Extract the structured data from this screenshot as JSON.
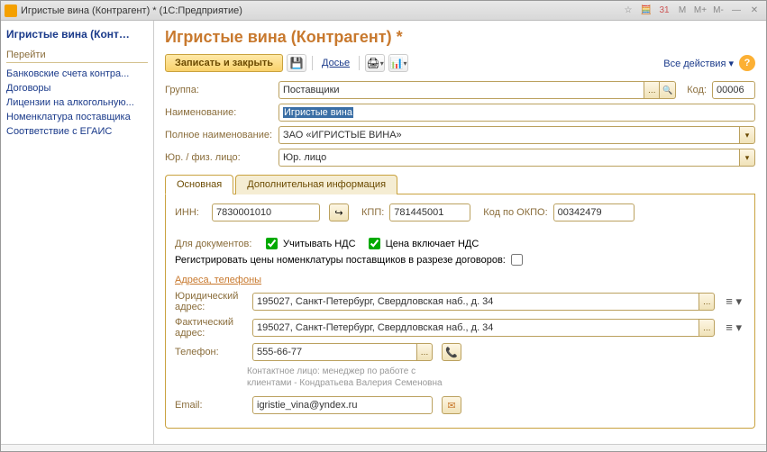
{
  "window": {
    "title": "Игристые вина (Контрагент) * (1С:Предприятие)",
    "controls": {
      "star": "☆",
      "calc": "🧮",
      "cal": "31",
      "m": "M",
      "mplus": "M+",
      "mminus": "M-",
      "min": "—",
      "close": "✕"
    }
  },
  "sidebar": {
    "title": "Игристые вина (Конт…",
    "section": "Перейти",
    "links": [
      "Банковские счета контра...",
      "Договоры",
      "Лицензии на алкогольную...",
      "Номенклатура поставщика",
      "Соответствие с ЕГАИС"
    ]
  },
  "page": {
    "title": "Игристые вина (Контрагент) *",
    "save_label": "Записать и закрыть",
    "dossier_label": "Досье",
    "all_actions_label": "Все действия ▾",
    "help": "?"
  },
  "fields": {
    "group_label": "Группа:",
    "group_value": "Поставщики",
    "code_label": "Код:",
    "code_value": "00006",
    "name_label": "Наименование:",
    "name_value": "Игристые вина",
    "fullname_label": "Полное наименование:",
    "fullname_value": "ЗАО «ИГРИСТЫЕ ВИНА»",
    "jurfiz_label": "Юр. / физ. лицо:",
    "jurfiz_value": "Юр. лицо"
  },
  "tabs": {
    "main": "Основная",
    "extra": "Дополнительная информация"
  },
  "tab_main": {
    "inn_label": "ИНН:",
    "inn_value": "7830001010",
    "kpp_label": "КПП:",
    "kpp_value": "781445001",
    "okpo_label": "Код по ОКПО:",
    "okpo_value": "00342479",
    "docs_label": "Для документов:",
    "vat_include_label": "Учитывать НДС",
    "vat_price_label": "Цена включает НДС",
    "reg_prices_label": "Регистрировать цены номенклатуры поставщиков в разрезе договоров:",
    "addr_section": "Адреса, телефоны",
    "legal_addr_label": "Юридический адрес:",
    "legal_addr_value": "195027, Санкт-Петербург, Свердловская наб., д. 34",
    "fact_addr_label": "Фактический адрес:",
    "fact_addr_value": "195027, Санкт-Петербург, Свердловская наб., д. 34",
    "phone_label": "Телефон:",
    "phone_value": "555-66-77",
    "contact_note": "Контактное лицо: менеджер по работе с клиентами - Кондратьева Валерия Семеновна",
    "email_label": "Email:",
    "email_value": "igristie_vina@yndex.ru"
  }
}
